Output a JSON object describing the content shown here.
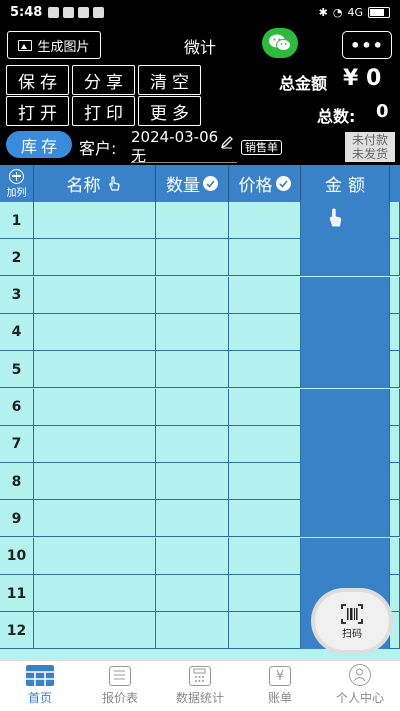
{
  "status_bar": {
    "time": "5:48",
    "right_text": "4G"
  },
  "header": {
    "generate_image_label": "生成图片",
    "title": "微计",
    "more_label": "•••"
  },
  "actions": {
    "save": "保存",
    "share": "分享",
    "clear": "清空",
    "open": "打开",
    "print": "打印",
    "more": "更多"
  },
  "summary": {
    "total_amount_label": "总金额",
    "total_amount_value": "¥ 0",
    "total_count_label": "总数:",
    "total_count_value": "0"
  },
  "customer": {
    "stock_label": "库存",
    "customer_label": "客户:",
    "date": "2024-03-06",
    "name": "无",
    "sales_tag": "销售单",
    "unpaid": "未付款",
    "unshipped": "未发货"
  },
  "table": {
    "add_column_label": "加列",
    "columns": [
      "名称",
      "数量",
      "价格",
      "金额"
    ],
    "rows": [
      "1",
      "2",
      "3",
      "4",
      "5",
      "6",
      "7",
      "8",
      "9",
      "10",
      "11",
      "12"
    ]
  },
  "scan": {
    "label": "扫码"
  },
  "nav": {
    "items": [
      {
        "label": "首页",
        "icon": "home-grid-icon",
        "active": true
      },
      {
        "label": "报价表",
        "icon": "quote-list-icon"
      },
      {
        "label": "数据统计",
        "icon": "calculator-icon"
      },
      {
        "label": "账单",
        "icon": "yuan-bill-icon"
      },
      {
        "label": "个人中心",
        "icon": "user-icon"
      }
    ]
  },
  "colors": {
    "header_blue": "#3a82c8",
    "cell_cyan": "#b3f2ee",
    "wechat_green": "#2dbb3e",
    "stock_blue": "#3a8bdc"
  }
}
